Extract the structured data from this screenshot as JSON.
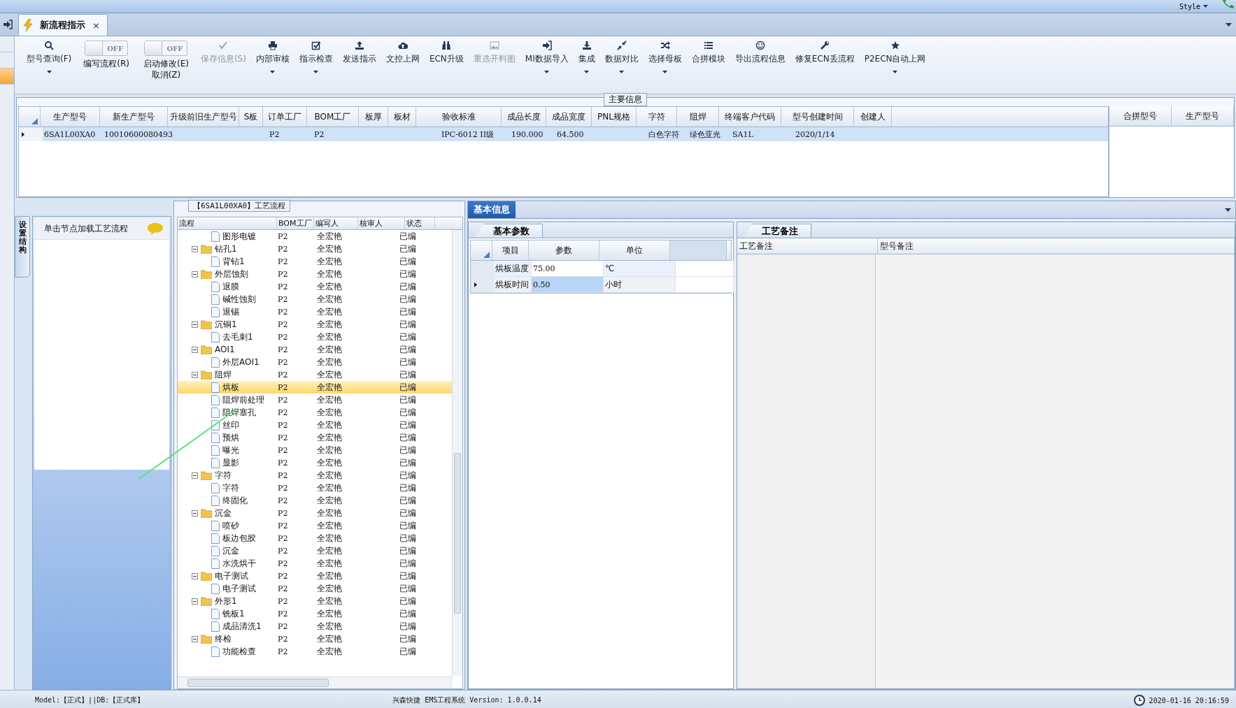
{
  "title_bar": {
    "style_label": "Style"
  },
  "document_tabs": [
    {
      "label": "新流程指示",
      "close": "×",
      "selected": true
    }
  ],
  "toolbar": [
    {
      "kind": "button",
      "label": "型号查询(F)",
      "disabled": false,
      "has_menu": true
    },
    {
      "kind": "toggle",
      "state_label": "OFF",
      "on": false,
      "label": "编写流程(R)"
    },
    {
      "kind": "toggle",
      "state_label": "OFF",
      "on": false,
      "label": "启动修改(E)",
      "label_2": "取消(Z)"
    },
    {
      "kind": "button",
      "label": "保存信息(S)",
      "disabled": true,
      "has_menu": false
    },
    {
      "kind": "button",
      "label": "内部审核",
      "disabled": false,
      "has_menu": true
    },
    {
      "kind": "button",
      "label": "指示检查",
      "disabled": false,
      "has_menu": true
    },
    {
      "kind": "button",
      "label": "发送指示",
      "disabled": false,
      "has_menu": false
    },
    {
      "kind": "button",
      "label": "文控上网",
      "disabled": false,
      "has_menu": false
    },
    {
      "kind": "button",
      "label": "ECN升级",
      "disabled": false,
      "has_menu": false
    },
    {
      "kind": "button",
      "label": "重选开料图",
      "disabled": true,
      "has_menu": false
    },
    {
      "kind": "button",
      "label": "MI数据导入",
      "disabled": false,
      "has_menu": true
    },
    {
      "kind": "button",
      "label": "集成",
      "disabled": false,
      "has_menu": true
    },
    {
      "kind": "button",
      "label": "数据对比",
      "disabled": false,
      "has_menu": true
    },
    {
      "kind": "button",
      "label": "选择母板",
      "disabled": false,
      "has_menu": true
    },
    {
      "kind": "button",
      "label": "合拼模块",
      "disabled": false,
      "has_menu": false
    },
    {
      "kind": "button",
      "label": "导出流程信息",
      "disabled": false,
      "has_menu": false
    },
    {
      "kind": "button",
      "label": "修复ECN丢流程",
      "disabled": false,
      "has_menu": false
    },
    {
      "kind": "button",
      "label": "P2ECN自动上网",
      "disabled": false,
      "has_menu": true
    }
  ],
  "main_info": {
    "title": "主要信息",
    "row_selected": true,
    "columns": [
      {
        "header": "生产型号",
        "value": "6SA1L00XA0"
      },
      {
        "header": "新生产型号",
        "value": "10010600080493"
      },
      {
        "header": "升级前旧生产型号"
      },
      {
        "header": "S板"
      },
      {
        "header": "订单工厂",
        "value": "P2"
      },
      {
        "header": "BOM工厂",
        "value": "P2"
      },
      {
        "header": "板厚"
      },
      {
        "header": "板材"
      },
      {
        "header": "验收标准",
        "value": "IPC-6012 II级"
      },
      {
        "header": "成品长度",
        "value": "190.000"
      },
      {
        "header": "成品宽度",
        "value": "64.500"
      },
      {
        "header": "PNL规格"
      },
      {
        "header": "字符",
        "value": "白色字符"
      },
      {
        "header": "阻焊",
        "value": "绿色亚光"
      },
      {
        "header": "终端客户代码",
        "value": "SA1L"
      },
      {
        "header": "型号创建时间",
        "value": "2020/1/14"
      },
      {
        "header": "创建人"
      }
    ],
    "side_columns": [
      "合拼型号",
      "生产型号"
    ]
  },
  "side_tab": {
    "label": "设置结构"
  },
  "node_panel": {
    "hint": "单击节点加载工艺流程"
  },
  "flow": {
    "title": "【6SA1L00XA0】工艺流程",
    "columns": [
      "流程",
      "BOM工厂",
      "编写人",
      "核审人",
      "状态"
    ],
    "tree": [
      {
        "kind": "file",
        "label": "图形电镀",
        "bom_factory": "P2",
        "writer": "全宏艳",
        "status": "已编",
        "selected": false
      },
      {
        "kind": "folder",
        "label": "钻孔1",
        "bom_factory": "P2",
        "writer": "全宏艳",
        "status": "已编",
        "selected": false,
        "expanded": true,
        "children": [
          {
            "kind": "file",
            "label": "背钻1",
            "bom_factory": "P2",
            "writer": "全宏艳",
            "status": "已编",
            "selected": false
          }
        ]
      },
      {
        "kind": "folder",
        "label": "外层蚀刻",
        "bom_factory": "P2",
        "writer": "全宏艳",
        "status": "已编",
        "selected": false,
        "expanded": true,
        "children": [
          {
            "kind": "file",
            "label": "退膜",
            "bom_factory": "P2",
            "writer": "全宏艳",
            "status": "已编",
            "selected": false
          },
          {
            "kind": "file",
            "label": "碱性蚀刻",
            "bom_factory": "P2",
            "writer": "全宏艳",
            "status": "已编",
            "selected": false
          },
          {
            "kind": "file",
            "label": "退锡",
            "bom_factory": "P2",
            "writer": "全宏艳",
            "status": "已编",
            "selected": false
          }
        ]
      },
      {
        "kind": "folder",
        "label": "沉铜1",
        "bom_factory": "P2",
        "writer": "全宏艳",
        "status": "已编",
        "selected": false,
        "expanded": true,
        "children": [
          {
            "kind": "file",
            "label": "去毛刺1",
            "bom_factory": "P2",
            "writer": "全宏艳",
            "status": "已编",
            "selected": false
          }
        ]
      },
      {
        "kind": "folder",
        "label": "AOI1",
        "bom_factory": "P2",
        "writer": "全宏艳",
        "status": "已编",
        "selected": false,
        "expanded": true,
        "children": [
          {
            "kind": "file",
            "label": "外层AOI1",
            "bom_factory": "P2",
            "writer": "全宏艳",
            "status": "已编",
            "selected": false
          }
        ]
      },
      {
        "kind": "folder",
        "label": "阻焊",
        "bom_factory": "P2",
        "writer": "全宏艳",
        "status": "已编",
        "selected": false,
        "expanded": true,
        "children": [
          {
            "kind": "file",
            "label": "烘板",
            "bom_factory": "P2",
            "writer": "全宏艳",
            "status": "已编",
            "selected": true
          },
          {
            "kind": "file",
            "label": "阻焊前处理",
            "bom_factory": "P2",
            "writer": "全宏艳",
            "status": "已编",
            "selected": false
          },
          {
            "kind": "file",
            "label": "阻焊塞孔",
            "bom_factory": "P2",
            "writer": "全宏艳",
            "status": "已编",
            "selected": false
          },
          {
            "kind": "file",
            "label": "丝印",
            "bom_factory": "P2",
            "writer": "全宏艳",
            "status": "已编",
            "selected": false
          },
          {
            "kind": "file",
            "label": "预烘",
            "bom_factory": "P2",
            "writer": "全宏艳",
            "status": "已编",
            "selected": false
          },
          {
            "kind": "file",
            "label": "曝光",
            "bom_factory": "P2",
            "writer": "全宏艳",
            "status": "已编",
            "selected": false
          },
          {
            "kind": "file",
            "label": "显影",
            "bom_factory": "P2",
            "writer": "全宏艳",
            "status": "已编",
            "selected": false
          }
        ]
      },
      {
        "kind": "folder",
        "label": "字符",
        "bom_factory": "P2",
        "writer": "全宏艳",
        "status": "已编",
        "selected": false,
        "expanded": true,
        "children": [
          {
            "kind": "file",
            "label": "字符",
            "bom_factory": "P2",
            "writer": "全宏艳",
            "status": "已编",
            "selected": false
          },
          {
            "kind": "file",
            "label": "终固化",
            "bom_factory": "P2",
            "writer": "全宏艳",
            "status": "已编",
            "selected": false
          }
        ]
      },
      {
        "kind": "folder",
        "label": "沉金",
        "bom_factory": "P2",
        "writer": "全宏艳",
        "status": "已编",
        "selected": false,
        "expanded": true,
        "children": [
          {
            "kind": "file",
            "label": "喷砂",
            "bom_factory": "P2",
            "writer": "全宏艳",
            "status": "已编",
            "selected": false
          },
          {
            "kind": "file",
            "label": "板边包胶",
            "bom_factory": "P2",
            "writer": "全宏艳",
            "status": "已编",
            "selected": false
          },
          {
            "kind": "file",
            "label": "沉金",
            "bom_factory": "P2",
            "writer": "全宏艳",
            "status": "已编",
            "selected": false
          },
          {
            "kind": "file",
            "label": "水洗烘干",
            "bom_factory": "P2",
            "writer": "全宏艳",
            "status": "已编",
            "selected": false
          }
        ]
      },
      {
        "kind": "folder",
        "label": "电子测试",
        "bom_factory": "P2",
        "writer": "全宏艳",
        "status": "已编",
        "selected": false,
        "expanded": true,
        "children": [
          {
            "kind": "file",
            "label": "电子测试",
            "bom_factory": "P2",
            "writer": "全宏艳",
            "status": "已编",
            "selected": false
          }
        ]
      },
      {
        "kind": "folder",
        "label": "外形1",
        "bom_factory": "P2",
        "writer": "全宏艳",
        "status": "已编",
        "selected": false,
        "expanded": true,
        "children": [
          {
            "kind": "file",
            "label": "铣板1",
            "bom_factory": "P2",
            "writer": "全宏艳",
            "status": "已编",
            "selected": false
          },
          {
            "kind": "file",
            "label": "成品清洗1",
            "bom_factory": "P2",
            "writer": "全宏艳",
            "status": "已编",
            "selected": false
          }
        ]
      },
      {
        "kind": "folder",
        "label": "终检",
        "bom_factory": "P2",
        "writer": "全宏艳",
        "status": "已编",
        "selected": false,
        "expanded": true,
        "children": [
          {
            "kind": "file",
            "label": "功能检查",
            "bom_factory": "P2",
            "writer": "全宏艳",
            "status": "已编",
            "selected": false
          }
        ]
      }
    ]
  },
  "detail": {
    "tabs": [
      {
        "label": "基本信息",
        "selected": true
      }
    ],
    "params": {
      "tab": {
        "label": "基本参数",
        "selected": true
      },
      "columns": [
        "项目",
        "参数",
        "单位"
      ],
      "rows": [
        {
          "item": "烘板温度",
          "value": "75.00",
          "unit": "℃",
          "selected": false
        },
        {
          "item": "烘板时间",
          "value": "0.50",
          "unit": "小时",
          "selected": true
        }
      ]
    },
    "notes": {
      "tab": {
        "label": "工艺备注",
        "selected": true
      },
      "columns": [
        "工艺备注",
        "型号备注"
      ]
    }
  },
  "status_bar": {
    "model": "Model:【正式】||DB:【正式库】",
    "product": "兴森快捷 EMS工程系统 Version: 1.0.0.14",
    "datetime": "2020-01-16 20:16:59"
  }
}
